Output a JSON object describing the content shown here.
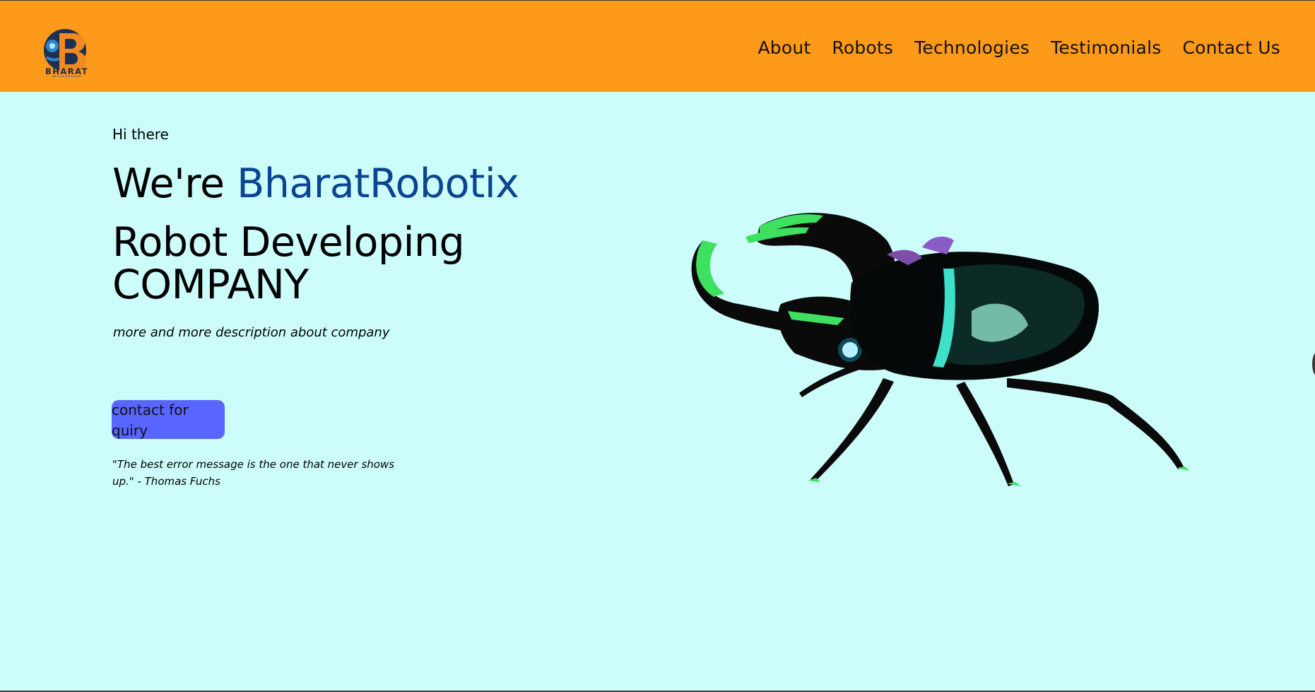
{
  "header": {
    "logo_text": "BHARAT",
    "nav": [
      {
        "label": "About"
      },
      {
        "label": "Robots"
      },
      {
        "label": "Technologies"
      },
      {
        "label": "Testimonials"
      },
      {
        "label": "Contact Us"
      }
    ]
  },
  "hero": {
    "greeting": "Hi there",
    "headline_prefix": "We're ",
    "brand_name": "BharatRobotix",
    "subheadline": "Robot Developing COMPANY",
    "description": "more and more description about company",
    "cta_label": "contact for quiry",
    "quote": "\"The best error message is the one that never shows up.\" - Thomas Fuchs"
  },
  "colors": {
    "header_bg": "#fe9a19",
    "page_bg": "#ccfdfb",
    "brand_text": "#0b4490",
    "cta_bg": "#5865ff"
  },
  "icons": {
    "logo": "bharat-robotix-logo",
    "hero_image": "robot-beetle-3d-model"
  }
}
